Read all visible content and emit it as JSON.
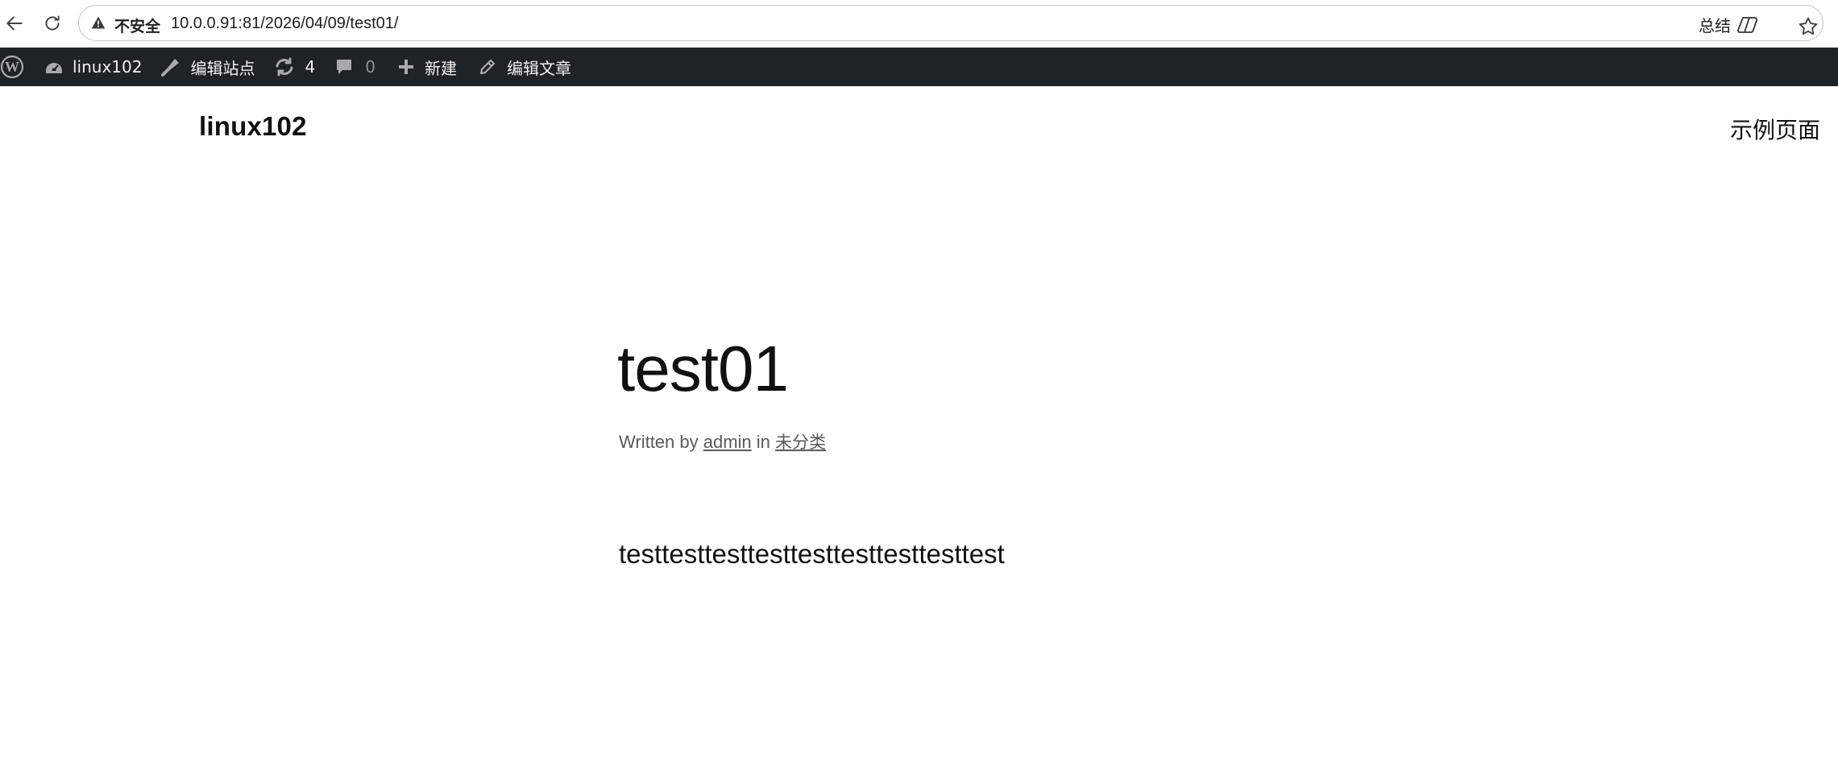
{
  "browser": {
    "security_label": "不安全",
    "url": "10.0.0.91:81/2026/04/09/test01/",
    "summary_label": "总结"
  },
  "admin_bar": {
    "site_name": "linux102",
    "customize_label": "编辑站点",
    "updates_count": "4",
    "comments_count": "0",
    "new_label": "新建",
    "edit_label": "编辑文章"
  },
  "site": {
    "title": "linux102",
    "nav_link": "示例页面"
  },
  "post": {
    "title": "test01",
    "meta_written_by": "Written by",
    "author": "admin",
    "meta_in": "in",
    "category": "未分类",
    "content": "testtesttesttesttesttesttesttesttest"
  }
}
